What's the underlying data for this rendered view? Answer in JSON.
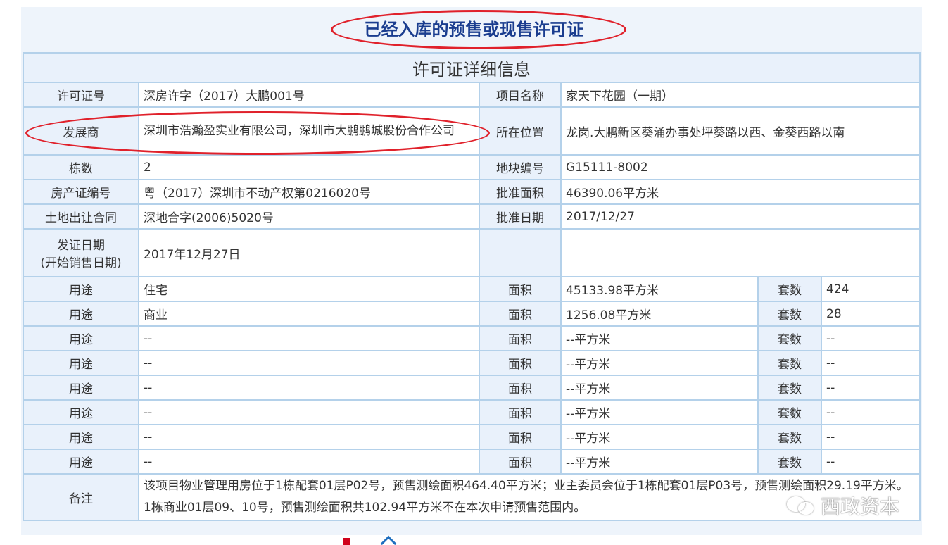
{
  "page": {
    "title": "已经入库的预售或现售许可证",
    "table_title": "许可证详细信息"
  },
  "permit": {
    "license_no_label": "许可证号",
    "license_no": "深房许字（2017）大鹏001号",
    "project_name_label": "项目名称",
    "project_name": "家天下花园（一期）",
    "developer_label": "发展商",
    "developer": "深圳市浩瀚盈实业有限公司，深圳市大鹏鹏城股份合作公司",
    "location_label": "所在位置",
    "location": "龙岗.大鹏新区葵涌办事处坪葵路以西、金葵西路以南",
    "buildings_label": "栋数",
    "buildings": "2",
    "plot_no_label": "地块编号",
    "plot_no": "G15111-8002",
    "property_cert_label": "房产证编号",
    "property_cert": "粤（2017）深圳市不动产权第0216020号",
    "approved_area_label": "批准面积",
    "approved_area": "46390.06平方米",
    "land_contract_label": "土地出让合同",
    "land_contract": "深地合字(2006)5020号",
    "approved_date_label": "批准日期",
    "approved_date": "2017/12/27",
    "issue_date_label_1": "发证日期",
    "issue_date_label_2": "(开始销售日期)",
    "issue_date": "2017年12月27日"
  },
  "usage_rows": [
    {
      "use_label": "用途",
      "use": "住宅",
      "area_label": "面积",
      "area": "45133.98平方米",
      "count_label": "套数",
      "count": "424"
    },
    {
      "use_label": "用途",
      "use": "商业",
      "area_label": "面积",
      "area": "1256.08平方米",
      "count_label": "套数",
      "count": "28"
    },
    {
      "use_label": "用途",
      "use": "--",
      "area_label": "面积",
      "area": "--平方米",
      "count_label": "套数",
      "count": "--"
    },
    {
      "use_label": "用途",
      "use": "--",
      "area_label": "面积",
      "area": "--平方米",
      "count_label": "套数",
      "count": "--"
    },
    {
      "use_label": "用途",
      "use": "--",
      "area_label": "面积",
      "area": "--平方米",
      "count_label": "套数",
      "count": "--"
    },
    {
      "use_label": "用途",
      "use": "--",
      "area_label": "面积",
      "area": "--平方米",
      "count_label": "套数",
      "count": "--"
    },
    {
      "use_label": "用途",
      "use": "--",
      "area_label": "面积",
      "area": "--平方米",
      "count_label": "套数",
      "count": "--"
    },
    {
      "use_label": "用途",
      "use": "--",
      "area_label": "面积",
      "area": "--平方米",
      "count_label": "套数",
      "count": "--"
    }
  ],
  "remark": {
    "label": "备注",
    "text": "该项目物业管理用房位于1栋配套01层P02号，预售测绘面积464.40平方米；业主委员会位于1栋配套01层P03号，预售测绘面积29.19平方米。1栋商业01层09、10号，预售测绘面积共102.94平方米不在本次申请预售范围内。"
  },
  "watermark": {
    "icon": "wechat-icon",
    "text": "西政资本"
  },
  "colors": {
    "title": "#1a3d8f",
    "highlight": "#e0212b",
    "border": "#b4d1ea",
    "label_bg": "#e9f1fb"
  }
}
